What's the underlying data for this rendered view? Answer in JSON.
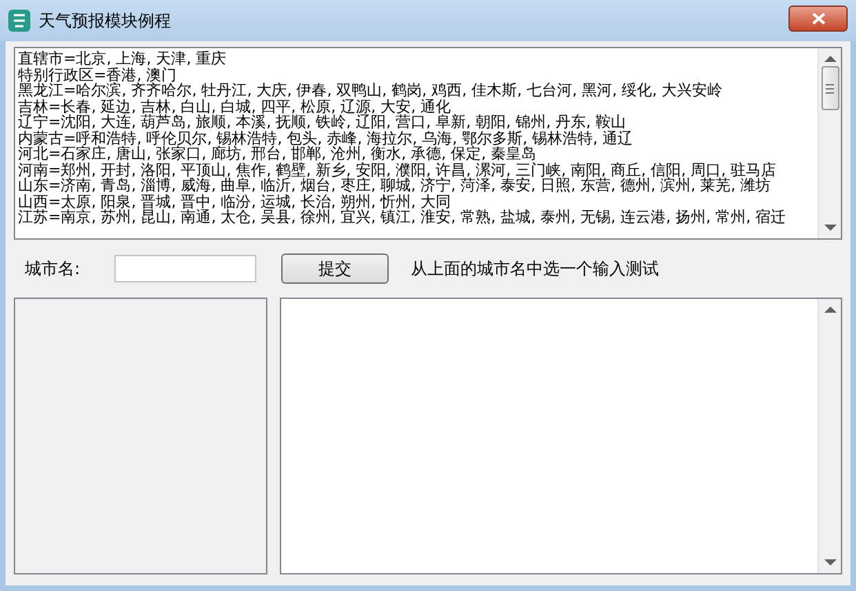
{
  "window": {
    "title": "天气预报模块例程"
  },
  "city_list": {
    "lines": [
      "直辖市=北京, 上海, 天津, 重庆",
      "特别行政区=香港, 澳门",
      "黑龙江=哈尔滨, 齐齐哈尔, 牡丹江, 大庆, 伊春, 双鸭山, 鹤岗, 鸡西, 佳木斯, 七台河, 黑河, 绥化, 大兴安岭",
      "吉林=长春, 延边, 吉林, 白山, 白城, 四平, 松原, 辽源, 大安, 通化",
      "辽宁=沈阳, 大连, 葫芦岛, 旅顺, 本溪, 抚顺, 铁岭, 辽阳, 营口, 阜新, 朝阳, 锦州, 丹东, 鞍山",
      "内蒙古=呼和浩特, 呼伦贝尔, 锡林浩特, 包头, 赤峰, 海拉尔, 乌海, 鄂尔多斯, 锡林浩特, 通辽",
      "河北=石家庄, 唐山, 张家口, 廊坊, 邢台, 邯郸, 沧州, 衡水, 承德, 保定, 秦皇岛",
      "河南=郑州, 开封, 洛阳, 平顶山, 焦作, 鹤壁, 新乡, 安阳, 濮阳, 许昌, 漯河, 三门峡, 南阳, 商丘, 信阳, 周口, 驻马店",
      "山东=济南, 青岛, 淄博, 威海, 曲阜, 临沂, 烟台, 枣庄, 聊城, 济宁, 菏泽, 泰安, 日照, 东营, 德州, 滨州, 莱芜, 潍坊",
      "山西=太原, 阳泉, 晋城, 晋中, 临汾, 运城, 长治, 朔州, 忻州, 大同",
      "江苏=南京, 苏州, 昆山, 南通, 太仓, 吴县, 徐州, 宜兴, 镇江, 淮安, 常熟, 盐城, 泰州, 无锡, 连云港, 扬州, 常州, 宿迁"
    ]
  },
  "form": {
    "label": "城市名:",
    "submit": "提交",
    "hint": "从上面的城市名中选一个输入测试"
  }
}
